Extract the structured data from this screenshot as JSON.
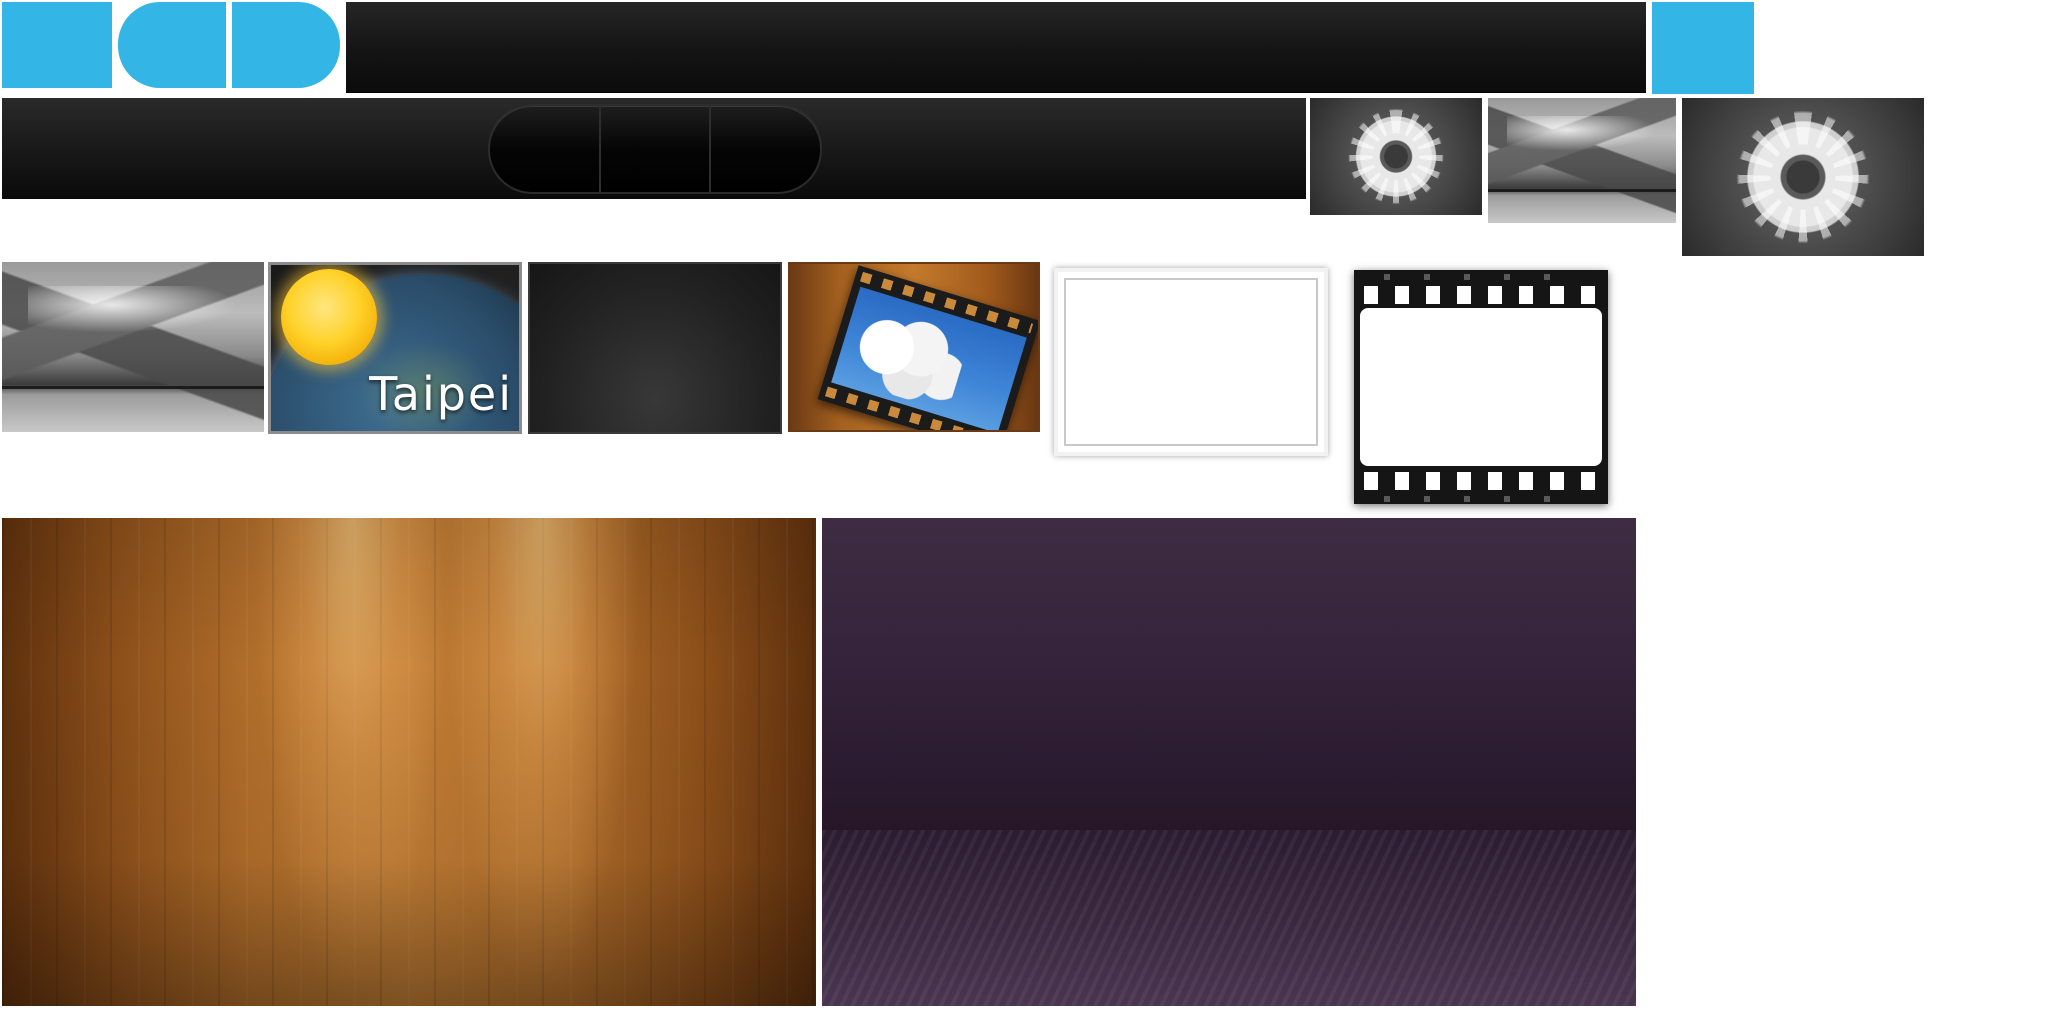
{
  "atlas": {
    "row1": {
      "tiles": [
        {
          "name": "blue-square-tile",
          "color": "#33b5e5"
        },
        {
          "name": "blue-pill-left-tile",
          "color": "#33b5e5"
        },
        {
          "name": "blue-pill-right-tile",
          "color": "#33b5e5"
        },
        {
          "name": "dark-title-bar",
          "color": "#141414"
        },
        {
          "name": "blue-small-tile",
          "color": "#33b5e5"
        }
      ]
    },
    "row2": {
      "toolbar_segments": 3,
      "thumbnails": [
        "sunflower-thumbnail",
        "mountain-thumbnail",
        "sunflower-large-thumbnail"
      ]
    },
    "row3": {
      "weather_tile": {
        "city": "Taipei",
        "icon": "sun-icon"
      },
      "frames": [
        "white-photo-frame",
        "film-strip-frame"
      ]
    },
    "row4": {
      "backgrounds": [
        {
          "name": "wood-stage-background",
          "color": "#b06d2a"
        },
        {
          "name": "purple-stage-background",
          "color": "#2a1a2e"
        }
      ]
    }
  }
}
